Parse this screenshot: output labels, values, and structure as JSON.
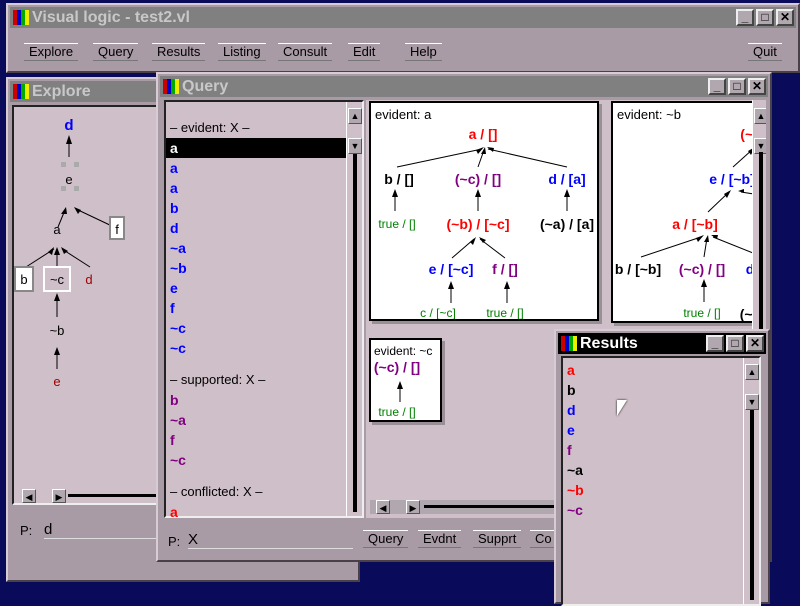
{
  "main": {
    "title": "Visual logic - test2.vl",
    "menu": [
      "Explore",
      "Query",
      "Results",
      "Listing",
      "Consult",
      "Edit",
      "Help"
    ],
    "quit": "Quit",
    "controls": [
      "_",
      "□",
      "✕"
    ]
  },
  "explore": {
    "title": "Explore",
    "nodes": {
      "d": "d",
      "e": "e",
      "a": "a",
      "f": "f",
      "b": "b",
      "nc": "~c",
      "d2": "d",
      "nb": "~b",
      "e2": "e"
    },
    "p_label": "P:",
    "p_value": "d"
  },
  "query": {
    "title": "Query",
    "sections": [
      {
        "header": "– evident: X –",
        "color": "#0000ff",
        "items": [
          "a",
          "a",
          "b",
          "d",
          "~a",
          "~b",
          "e",
          "f",
          "~c",
          "~c"
        ]
      },
      {
        "header": "– supported: X –",
        "color": "#800080",
        "items": [
          "b",
          "~a",
          "f",
          "~c"
        ]
      },
      {
        "header": "– conflicted: X –",
        "color": "#ff0000",
        "items": [
          "a"
        ]
      }
    ],
    "selected_item": "a",
    "panels": {
      "a": {
        "title": "evident: a",
        "nodes": [
          "a / []",
          "b / []",
          "(~c) / []",
          "d / [a]",
          "true / []",
          "(~b) / [~c]",
          "(~a) / [a]",
          "e / [~c]",
          "f / []",
          "c / [~c]",
          "true / []"
        ]
      },
      "nb": {
        "title": "evident: ~b",
        "nodes": [
          "(~b",
          "e / [~b]",
          "a / [~b]",
          "b / [~b]",
          "(~c) / []",
          "d",
          "true / []",
          "(~a"
        ]
      },
      "nc": {
        "title": "evident: ~c",
        "nodes": [
          "(~c) / []",
          "true / []"
        ]
      }
    },
    "p_label": "P:",
    "p_value": "X",
    "buttons": [
      "Query",
      "Evdnt",
      "Supprt",
      "Co"
    ]
  },
  "results": {
    "title": "Results",
    "items": [
      {
        "t": "a",
        "c": "#ff0000"
      },
      {
        "t": "b",
        "c": "#000000"
      },
      {
        "t": "d",
        "c": "#0000ff"
      },
      {
        "t": "e",
        "c": "#0000ff"
      },
      {
        "t": "f",
        "c": "#800080"
      },
      {
        "t": "~a",
        "c": "#000000"
      },
      {
        "t": "~b",
        "c": "#ff0000"
      },
      {
        "t": "~c",
        "c": "#800080"
      }
    ]
  },
  "colors": {
    "red": "#ff0000",
    "blue": "#0000ff",
    "purple": "#800080",
    "green": "#008000",
    "dark_red": "#a00000"
  }
}
